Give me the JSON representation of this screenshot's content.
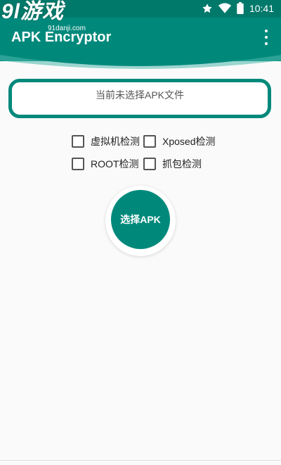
{
  "status_bar": {
    "time": "10:41",
    "icons": [
      "star-icon",
      "wifi-icon",
      "battery-icon"
    ]
  },
  "watermark": {
    "main": "9l游戏",
    "sub": "91danji.com"
  },
  "app_bar": {
    "title": "APK Encryptor",
    "menu_icon": "more-vert-icon"
  },
  "file_status": {
    "text": "当前未选择APK文件"
  },
  "options": [
    {
      "label": "虚拟机检测",
      "checked": false
    },
    {
      "label": "Xposed检测",
      "checked": false
    },
    {
      "label": "ROOT检测",
      "checked": false
    },
    {
      "label": "抓包检测",
      "checked": false
    }
  ],
  "select_button": {
    "label": "选择APK"
  },
  "colors": {
    "primary": "#00897b",
    "primary_dark": "#00796b",
    "background": "#fafafa"
  }
}
